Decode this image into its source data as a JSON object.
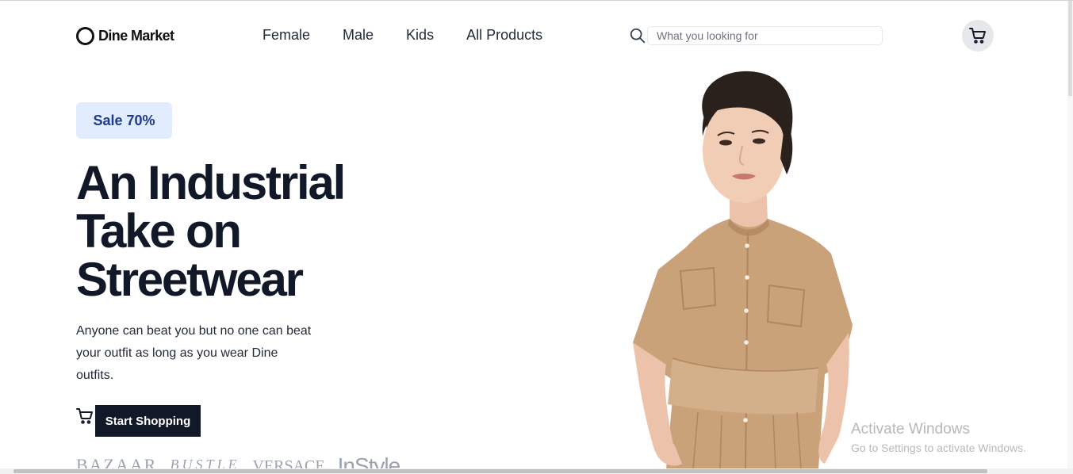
{
  "header": {
    "logo_text": "Dine Market",
    "nav": [
      "Female",
      "Male",
      "Kids",
      "All Products"
    ],
    "search": {
      "placeholder": "What you looking for",
      "icon": "search-icon"
    },
    "cart_icon": "cart-icon"
  },
  "hero": {
    "badge": "Sale 70%",
    "headline": [
      "An Industrial",
      "Take on",
      "Streetwear"
    ],
    "subtext": "Anyone can beat you but no one can beat your outfit as long as you wear Dine outfits.",
    "cta_label": "Start Shopping",
    "cta_icon": "cart-icon",
    "brands": [
      "BAZAAR",
      "BUSTLE",
      "VERSACE",
      "InStyle"
    ]
  },
  "watermark": {
    "title": "Activate Windows",
    "subtitle": "Go to Settings to activate Windows."
  },
  "colors": {
    "dark": "#111827",
    "badge_bg": "#e1edff",
    "badge_text": "#1e3a8a",
    "cart_bg": "#e5e7eb"
  }
}
